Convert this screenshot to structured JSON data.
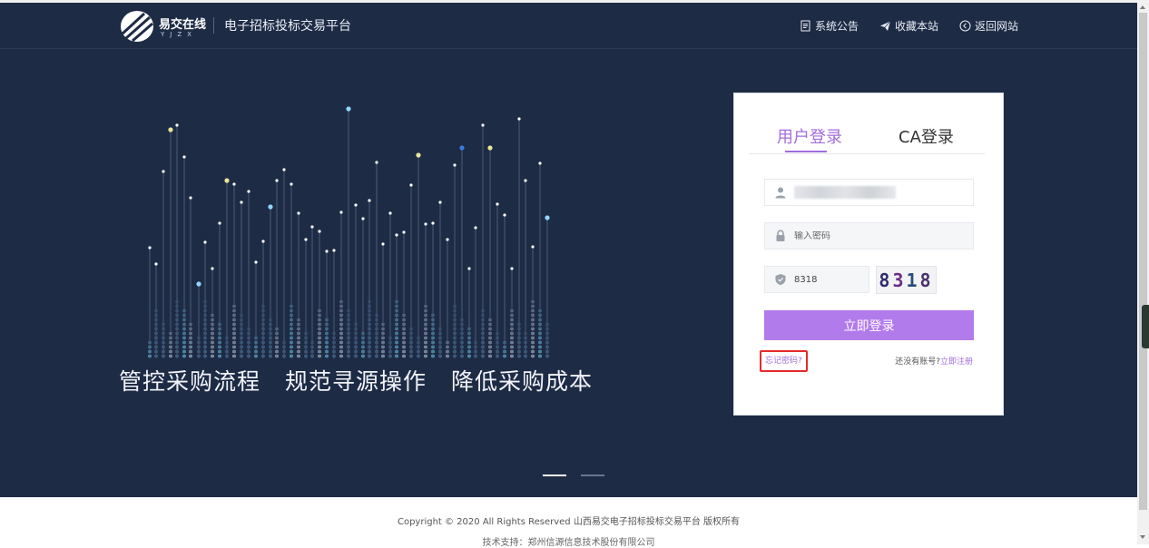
{
  "header": {
    "logo_cn": "易交在线",
    "logo_en": "YJZX",
    "site_title": "电子招标投标交易平台",
    "nav": [
      {
        "label": "系统公告",
        "icon": "document-icon"
      },
      {
        "label": "收藏本站",
        "icon": "send-icon"
      },
      {
        "label": "返回网站",
        "icon": "back-circle-icon"
      }
    ]
  },
  "hero": {
    "slogans": [
      "管控采购流程",
      "规范寻源操作",
      "降低采购成本"
    ],
    "carousel": {
      "count": 2,
      "active": 1
    }
  },
  "login": {
    "tabs": [
      {
        "label": "用户登录",
        "active": true
      },
      {
        "label": "CA登录",
        "active": false
      }
    ],
    "username_value": "",
    "password_placeholder": "输入密码",
    "captcha_value": "8318",
    "captcha_image_text": "8318",
    "submit_label": "立即登录",
    "forgot_label": "忘记密码?",
    "register_prefix": "还没有账号?",
    "register_label": "立即注册"
  },
  "footer": {
    "copyright": "Copyright © 2020 All Rights Reserved 山西易交电子招标投标交易平台 版权所有",
    "support": "技术支持：郑州信源信息技术股份有限公司"
  },
  "colors": {
    "hero_bg": "#1e2b45",
    "accent": "#a26ddc",
    "button": "#b27bec",
    "highlight_box": "#e62a2a"
  }
}
